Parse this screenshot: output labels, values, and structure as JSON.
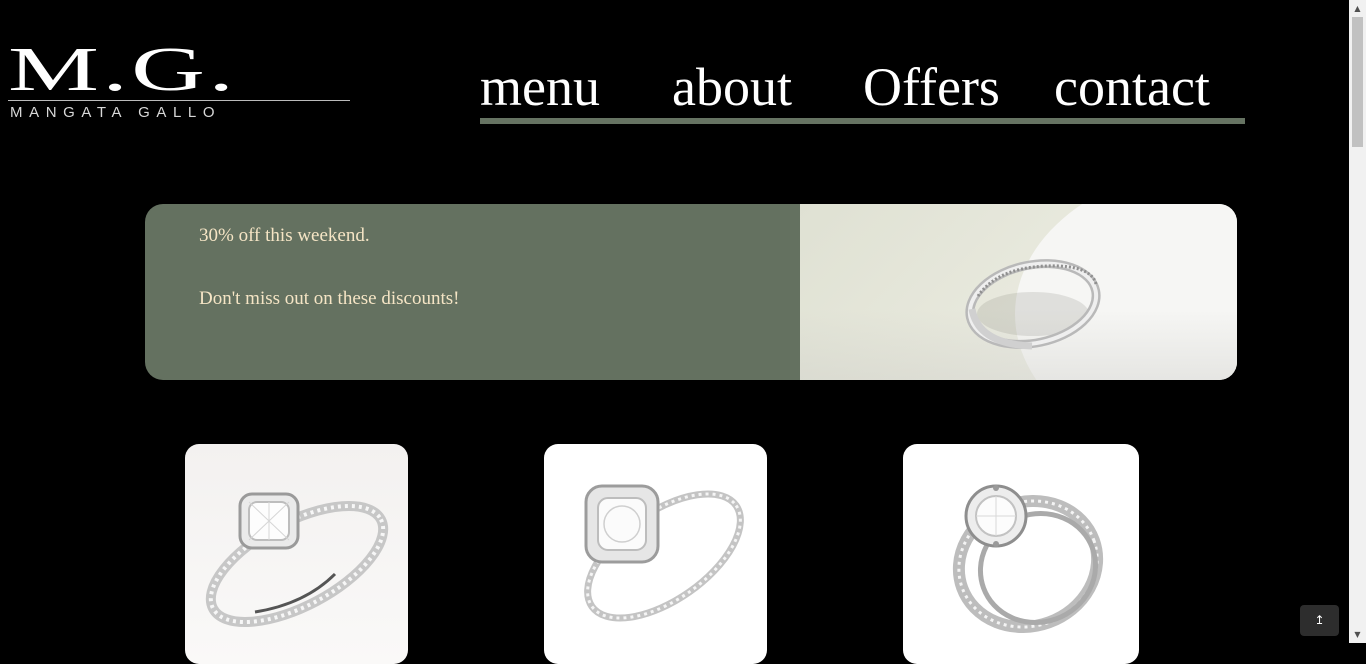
{
  "logo": {
    "letters": "M.G.",
    "subtitle": "MANGATA GALLO"
  },
  "nav": {
    "items": [
      {
        "label": "menu"
      },
      {
        "label": "about"
      },
      {
        "label": "Offers"
      },
      {
        "label": "contact"
      }
    ]
  },
  "banner": {
    "line1": "30% off this weekend.",
    "line2": "Don't miss out on these discounts!"
  },
  "products": [
    {
      "icon": "ring-cushion-halo-image"
    },
    {
      "icon": "ring-halo-image"
    },
    {
      "icon": "ring-split-shank-image"
    }
  ],
  "back_to_top": {
    "label": "↥"
  },
  "colors": {
    "background": "#000000",
    "accent_green": "#667362",
    "banner_text": "#f5e5c5"
  }
}
